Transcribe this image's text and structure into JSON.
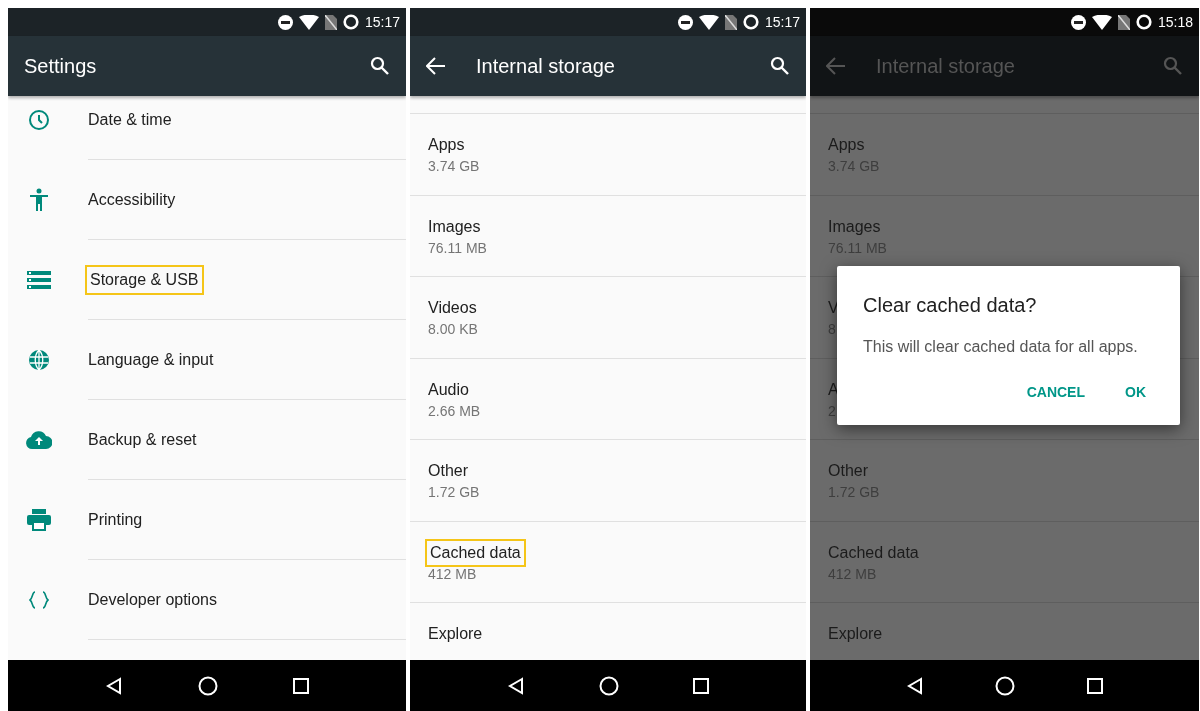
{
  "phones": [
    {
      "status_time": "15:17",
      "dimmed": false,
      "toolbar": {
        "title": "Settings"
      },
      "kind": "settings",
      "items": [
        {
          "label": "Date & time",
          "highlighted": false
        },
        {
          "label": "Accessibility",
          "highlighted": false
        },
        {
          "label": "Storage & USB",
          "highlighted": true
        },
        {
          "label": "Language & input",
          "highlighted": false
        },
        {
          "label": "Backup & reset",
          "highlighted": false
        },
        {
          "label": "Printing",
          "highlighted": false
        },
        {
          "label": "Developer options",
          "highlighted": false
        }
      ]
    },
    {
      "status_time": "15:17",
      "dimmed": false,
      "toolbar": {
        "title": "Internal storage"
      },
      "kind": "storage",
      "items": [
        {
          "label": "Apps",
          "size": "3.74 GB",
          "highlighted": false
        },
        {
          "label": "Images",
          "size": "76.11 MB",
          "highlighted": false
        },
        {
          "label": "Videos",
          "size": "8.00 KB",
          "highlighted": false
        },
        {
          "label": "Audio",
          "size": "2.66 MB",
          "highlighted": false
        },
        {
          "label": "Other",
          "size": "1.72 GB",
          "highlighted": false
        },
        {
          "label": "Cached data",
          "size": "412 MB",
          "highlighted": true
        },
        {
          "label": "Explore",
          "highlighted": false
        }
      ]
    },
    {
      "status_time": "15:18",
      "dimmed": true,
      "toolbar": {
        "title": "Internal storage"
      },
      "kind": "storage",
      "items": [
        {
          "label": "Apps",
          "size": "3.74 GB",
          "highlighted": false
        },
        {
          "label": "Images",
          "size": "76.11 MB",
          "highlighted": false
        },
        {
          "label": "V",
          "size": "8",
          "highlighted": false
        },
        {
          "label": "A",
          "size": "2",
          "highlighted": false
        },
        {
          "label": "Other",
          "size": "1.72 GB",
          "highlighted": false
        },
        {
          "label": "Cached data",
          "size": "412 MB",
          "highlighted": false
        },
        {
          "label": "Explore",
          "highlighted": false
        }
      ],
      "dialog": {
        "title": "Clear cached data?",
        "message": "This will clear cached data for all apps.",
        "buttons": [
          "CANCEL",
          "OK"
        ]
      }
    }
  ]
}
